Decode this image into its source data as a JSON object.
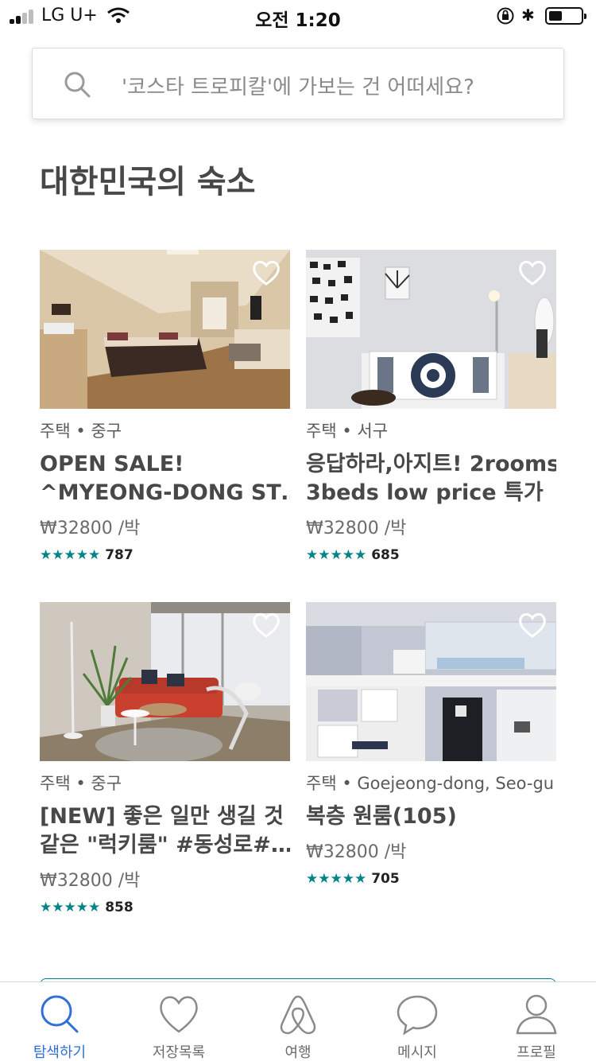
{
  "status_bar": {
    "carrier": "LG U+",
    "time": "오전 1:20",
    "bluetooth_glyph": "✱"
  },
  "search": {
    "placeholder": "'코스타 트로피칼'에 가보는 건 어떠세요?"
  },
  "section": {
    "title": "대한민국의 숙소"
  },
  "listings": [
    {
      "meta": "주택 • 중구",
      "title_line1": "OPEN SALE!",
      "title_line2": "^MYEONG-DONG ST…",
      "price": "₩32800 /박",
      "stars": "★★★★★",
      "reviews": "787",
      "photo": "bedroom-photo"
    },
    {
      "meta": "주택 • 서구",
      "title_line1": "응답하라,아지트! 2rooms",
      "title_line2": "3beds low price 특가",
      "price": "₩32800 /박",
      "stars": "★★★★★",
      "reviews": "685",
      "photo": "sofa-room-photo"
    },
    {
      "meta": "주택 • 중구",
      "title_line1": "[NEW] 좋은 일만 생길 것",
      "title_line2": "같은 \"럭키룸\" #동성로#…",
      "price": "₩32800 /박",
      "stars": "★★★★★",
      "reviews": "858",
      "photo": "living-room-photo"
    },
    {
      "meta": "주택 • Goejeong-dong, Seo-gu",
      "title_line1": "복층 원룸(105)",
      "title_line2": "",
      "price": "₩32800 /박",
      "stars": "★★★★★",
      "reviews": "705",
      "photo": "loft-room-photo"
    }
  ],
  "tabs": [
    {
      "label": "탐색하기",
      "icon": "search-icon",
      "active": true
    },
    {
      "label": "저장목록",
      "icon": "heart-icon",
      "active": false
    },
    {
      "label": "여행",
      "icon": "airbnb-logo-icon",
      "active": false
    },
    {
      "label": "메시지",
      "icon": "chat-bubble-icon",
      "active": false
    },
    {
      "label": "프로필",
      "icon": "profile-icon",
      "active": false
    }
  ],
  "colors": {
    "accent_teal": "#008489",
    "active_tab_blue": "#2f6fd6",
    "text_dark": "#484848"
  }
}
